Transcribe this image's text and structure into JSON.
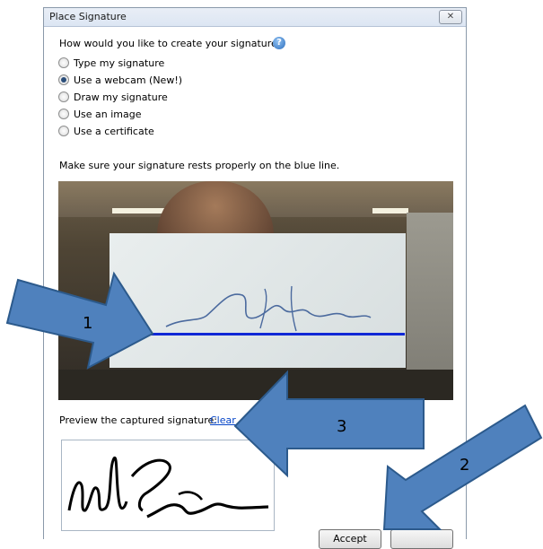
{
  "dialog": {
    "title": "Place Signature",
    "close_glyph": "✕",
    "question": "How would you like to create your signature?",
    "help_glyph": "?",
    "options": [
      {
        "label": "Type my signature",
        "checked": false
      },
      {
        "label": "Use a webcam (New!)",
        "checked": true
      },
      {
        "label": "Draw my signature",
        "checked": false
      },
      {
        "label": "Use an image",
        "checked": false
      },
      {
        "label": "Use a certificate",
        "checked": false
      }
    ],
    "instruction": "Make sure your signature rests properly on the blue line.",
    "preview_label": "Preview the captured signature:",
    "clear_link": "Clear",
    "accept_label": "Accept",
    "cancel_label": ""
  },
  "annotations": {
    "arrow1": "1",
    "arrow2": "2",
    "arrow3": "3"
  },
  "colors": {
    "arrow_fill": "#4f81bd",
    "arrow_stroke": "#2c5a8c",
    "baseline": "#1028d6",
    "link": "#0645c8"
  }
}
